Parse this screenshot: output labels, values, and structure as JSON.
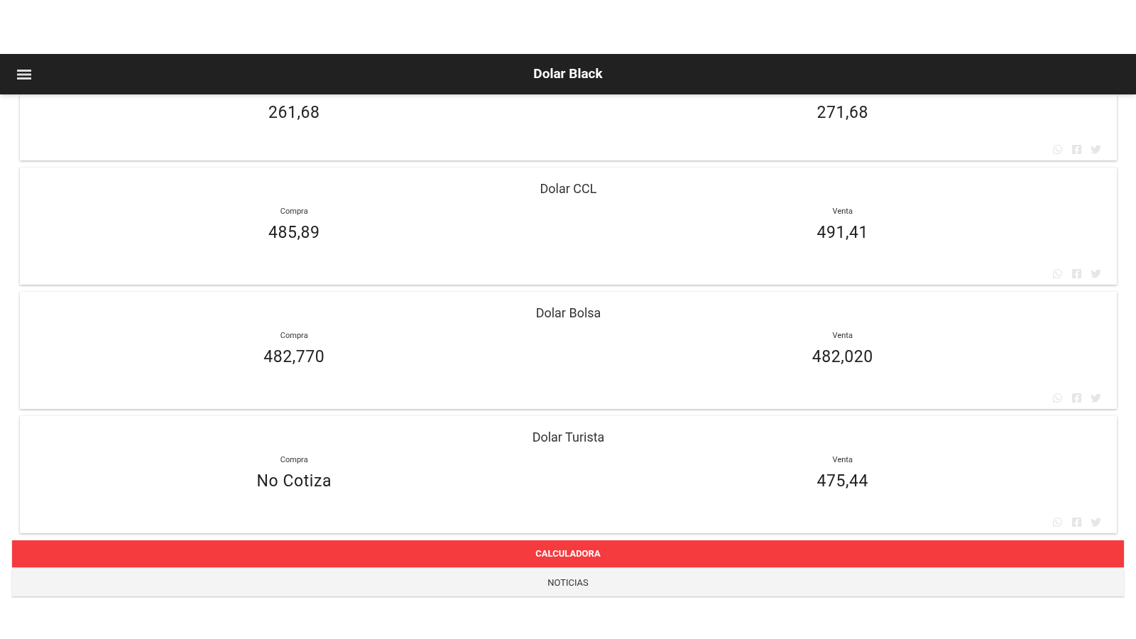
{
  "app_bar": {
    "title": "Dolar Black"
  },
  "cards": [
    {
      "buy_value": "261,68",
      "sell_value": "271,68"
    },
    {
      "title": "Dolar CCL",
      "buy_label": "Compra",
      "buy_value": "485,89",
      "sell_label": "Venta",
      "sell_value": "491,41"
    },
    {
      "title": "Dolar Bolsa",
      "buy_label": "Compra",
      "buy_value": "482,770",
      "sell_label": "Venta",
      "sell_value": "482,020"
    },
    {
      "title": "Dolar Turista",
      "buy_label": "Compra",
      "buy_value": "No Cotiza",
      "sell_label": "Venta",
      "sell_value": "475,44"
    }
  ],
  "tabs": [
    {
      "label": "CALCULADORA",
      "selected": true
    },
    {
      "label": "NOTICIAS",
      "selected": false
    }
  ]
}
